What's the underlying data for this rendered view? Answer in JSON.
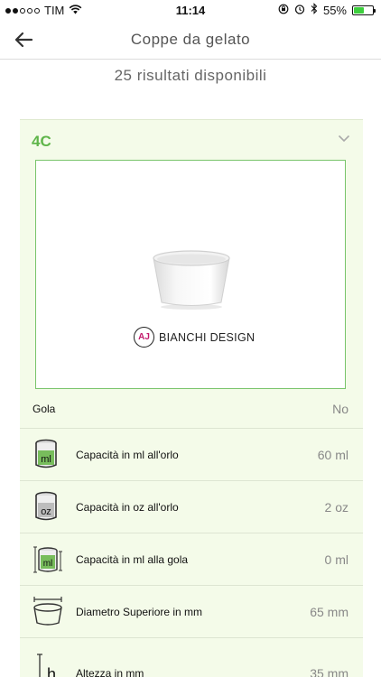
{
  "status_bar": {
    "carrier": "TIM",
    "time": "11:14",
    "battery_percent": "55%",
    "battery_level": 0.55,
    "icons": [
      "signal-dots-icon",
      "wifi-icon",
      "orientation-lock-icon",
      "alarm-icon",
      "bluetooth-icon",
      "battery-icon"
    ]
  },
  "nav": {
    "back_icon": "arrow-left-icon",
    "title": "Coppe da gelato"
  },
  "results_text": "25 risultati disponibili",
  "product": {
    "code": "4C",
    "chevron_icon": "chevron-down-icon",
    "brand_badge": "AJ",
    "brand_name": "BIANCHI DESIGN",
    "specs": [
      {
        "label": "Gola",
        "value": "No",
        "icon": ""
      },
      {
        "label": "Capacità in ml all'orlo",
        "value": "60 ml",
        "icon": "cup-ml-icon",
        "icon_text": "ml"
      },
      {
        "label": "Capacità in oz all'orlo",
        "value": "2 oz",
        "icon": "cup-oz-icon",
        "icon_text": "oz"
      },
      {
        "label": "Capacità in ml alla gola",
        "value": "0 ml",
        "icon": "cup-ml-gola-icon",
        "icon_text": "ml"
      },
      {
        "label": "Diametro Superiore in mm",
        "value": "65 mm",
        "icon": "top-diameter-icon"
      },
      {
        "label": "Altezza in mm",
        "value": "35 mm",
        "icon": "height-icon",
        "icon_text": "h"
      }
    ]
  },
  "colors": {
    "accent_green": "#5fb54a",
    "card_background": "#f4fbe9",
    "image_border": "#79c46b",
    "battery_green": "#3ecf3e",
    "brand_magenta": "#c2186b"
  }
}
